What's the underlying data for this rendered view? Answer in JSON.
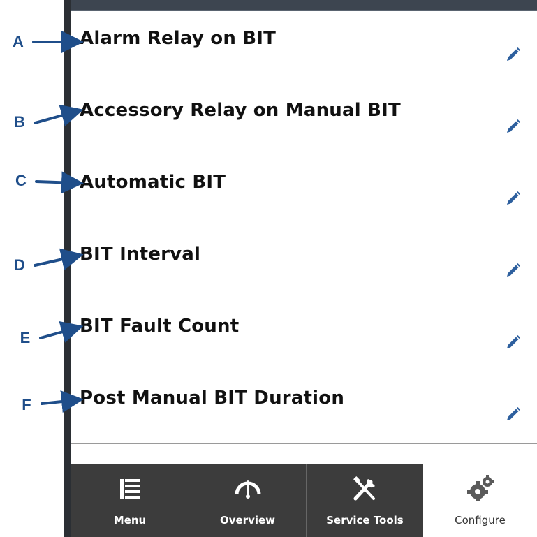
{
  "list": {
    "items": [
      {
        "label": "Alarm Relay on BIT"
      },
      {
        "label": "Accessory Relay on Manual BIT"
      },
      {
        "label": "Automatic BIT"
      },
      {
        "label": "BIT Interval"
      },
      {
        "label": "BIT Fault Count"
      },
      {
        "label": "Post Manual BIT Duration"
      }
    ],
    "edit_icon": "pencil-icon"
  },
  "callouts": [
    "A",
    "B",
    "C",
    "D",
    "E",
    "F"
  ],
  "nav": {
    "tabs": [
      {
        "label": "Menu",
        "icon": "list-icon"
      },
      {
        "label": "Overview",
        "icon": "gauge-icon"
      },
      {
        "label": "Service Tools",
        "icon": "tools-icon"
      },
      {
        "label": "Configure",
        "icon": "gears-icon",
        "active": true
      }
    ]
  },
  "colors": {
    "callout": "#1f4e8a",
    "nav_background": "#3c3c3c",
    "edit_icon": "#2d5f9e"
  }
}
